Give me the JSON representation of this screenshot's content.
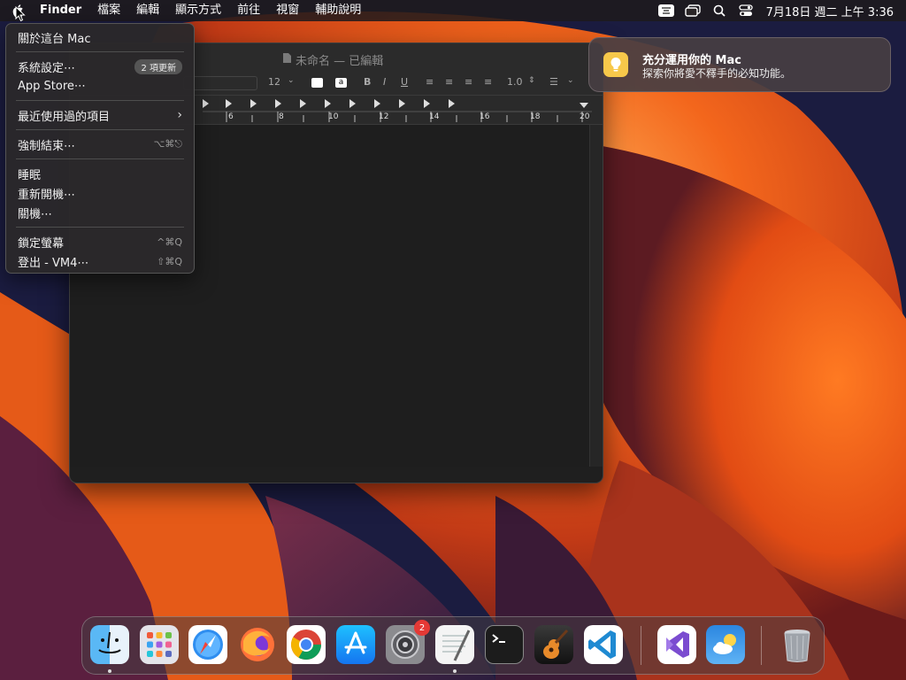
{
  "menubar": {
    "app_name": "Finder",
    "items": [
      "檔案",
      "編輯",
      "顯示方式",
      "前往",
      "視窗",
      "輔助說明"
    ],
    "clock": "7月18日 週二 上午 3:36",
    "status_icons": [
      "input-method-icon",
      "screen-mirroring-icon",
      "spotlight-search-icon",
      "control-center-icon"
    ]
  },
  "apple_menu": {
    "about": "關於這台 Mac",
    "settings": "系統設定⋯",
    "settings_badge": "2 項更新",
    "app_store": "App Store⋯",
    "recent": "最近使用過的項目",
    "force_quit": "強制結束⋯",
    "force_quit_shortcut": "⌥⌘⎋",
    "sleep": "睡眠",
    "restart": "重新開機⋯",
    "shutdown": "關機⋯",
    "lock": "鎖定螢幕",
    "lock_shortcut": "^⌘Q",
    "logout": "登出 - VM4⋯",
    "logout_shortcut": "⇧⌘Q"
  },
  "textedit": {
    "title": "未命名 — 已編輯",
    "font_size": "12",
    "line_spacing": "1.0",
    "ruler_numbers": [
      "6",
      "8",
      "10",
      "12",
      "14",
      "16",
      "18",
      "20"
    ]
  },
  "notification": {
    "title": "充分運用你的 Mac",
    "body": "探索你將愛不釋手的必知功能。"
  },
  "dock": {
    "items": [
      "finder",
      "launchpad",
      "safari",
      "firefox",
      "chrome",
      "app-store",
      "system-settings",
      "textedit",
      "terminal",
      "garageband",
      "vscode",
      "visual-studio",
      "weather",
      "trash"
    ],
    "settings_badge": "2"
  },
  "colors": {
    "wallpaper_orange": "#f26a1b",
    "wallpaper_dark": "#1b1c40",
    "badge_red": "#e53935"
  }
}
